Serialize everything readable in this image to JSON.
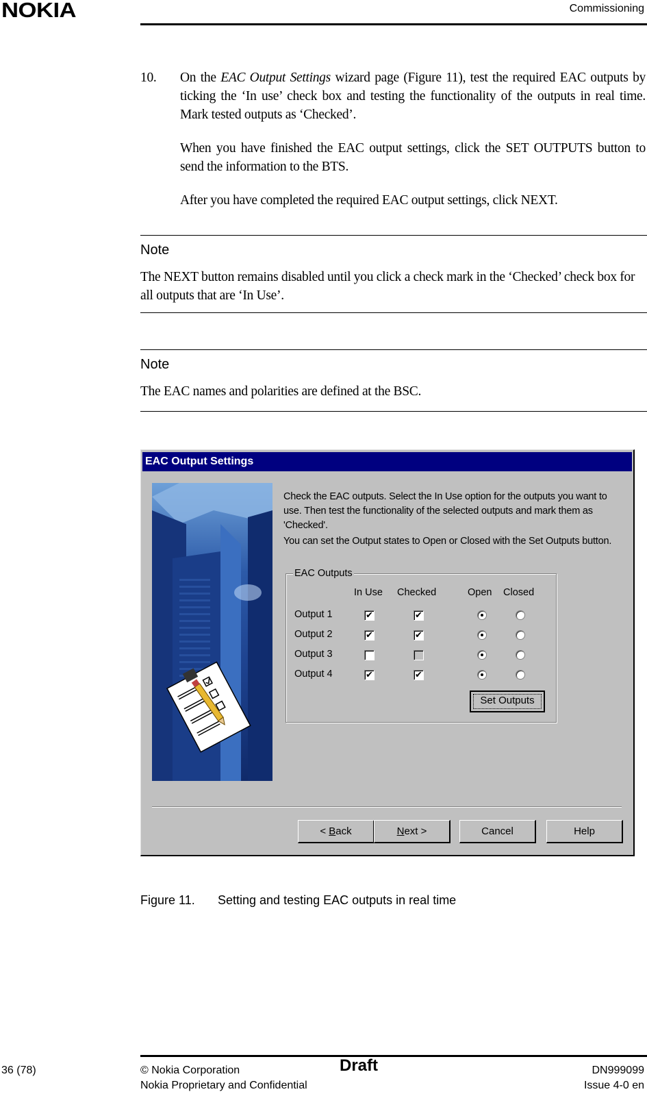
{
  "header": {
    "logo": "NOKIA",
    "section_title": "Commissioning"
  },
  "step": {
    "number": "10.",
    "para1_prefix": "On the ",
    "para1_italic": "EAC Output Settings",
    "para1_suffix": " wizard page (Figure 11), test the required EAC outputs by ticking the ‘In use’ check box and testing the functionality of the outputs in real time. Mark tested outputs as ‘Checked’.",
    "para2": "When you have finished the EAC output settings, click the SET OUTPUTS button to send the information to the BTS.",
    "para3": "After you have completed the required EAC output settings, click NEXT."
  },
  "notes": [
    {
      "title": "Note",
      "text": "The NEXT button remains disabled until you click a check mark in the ‘Checked’ check box for all outputs that are ‘In Use’."
    },
    {
      "title": "Note",
      "text": "The EAC names and polarities are defined at the BSC."
    }
  ],
  "dialog": {
    "title": "EAC Output Settings",
    "image_icon": "clipboard-checklist-pencil",
    "instruction1": "Check the EAC outputs. Select the In Use option for the outputs you want to use. Then test the functionality of the selected outputs and mark them as 'Checked'.",
    "instruction2": "You can set the Output states to Open or Closed with the Set Outputs button.",
    "group_label": "EAC Outputs",
    "columns": {
      "in_use": "In Use",
      "checked": "Checked",
      "open": "Open",
      "closed": "Closed"
    },
    "outputs": [
      {
        "label": "Output 1",
        "in_use": true,
        "checked": true,
        "checked_enabled": true,
        "state": "open"
      },
      {
        "label": "Output 2",
        "in_use": true,
        "checked": true,
        "checked_enabled": true,
        "state": "open"
      },
      {
        "label": "Output 3",
        "in_use": false,
        "checked": false,
        "checked_enabled": false,
        "state": "open"
      },
      {
        "label": "Output 4",
        "in_use": true,
        "checked": true,
        "checked_enabled": true,
        "state": "open"
      }
    ],
    "set_outputs_label": "Set Outputs",
    "buttons": {
      "back_prefix": "< ",
      "back_mnemonic": "B",
      "back_rest": "ack",
      "next_mnemonic": "N",
      "next_rest": "ext >",
      "cancel": "Cancel",
      "help": "Help"
    },
    "colors": {
      "titlebar": "#000080",
      "face": "#c0c0c0"
    }
  },
  "figure": {
    "label": "Figure 11.",
    "caption": "Setting and testing EAC outputs in real time"
  },
  "footer": {
    "page": "36 (78)",
    "copyright": "© Nokia Corporation",
    "confidential": "Nokia Proprietary and Confidential",
    "status": "Draft",
    "doc_id": "DN999099",
    "issue": "Issue 4-0 en"
  }
}
